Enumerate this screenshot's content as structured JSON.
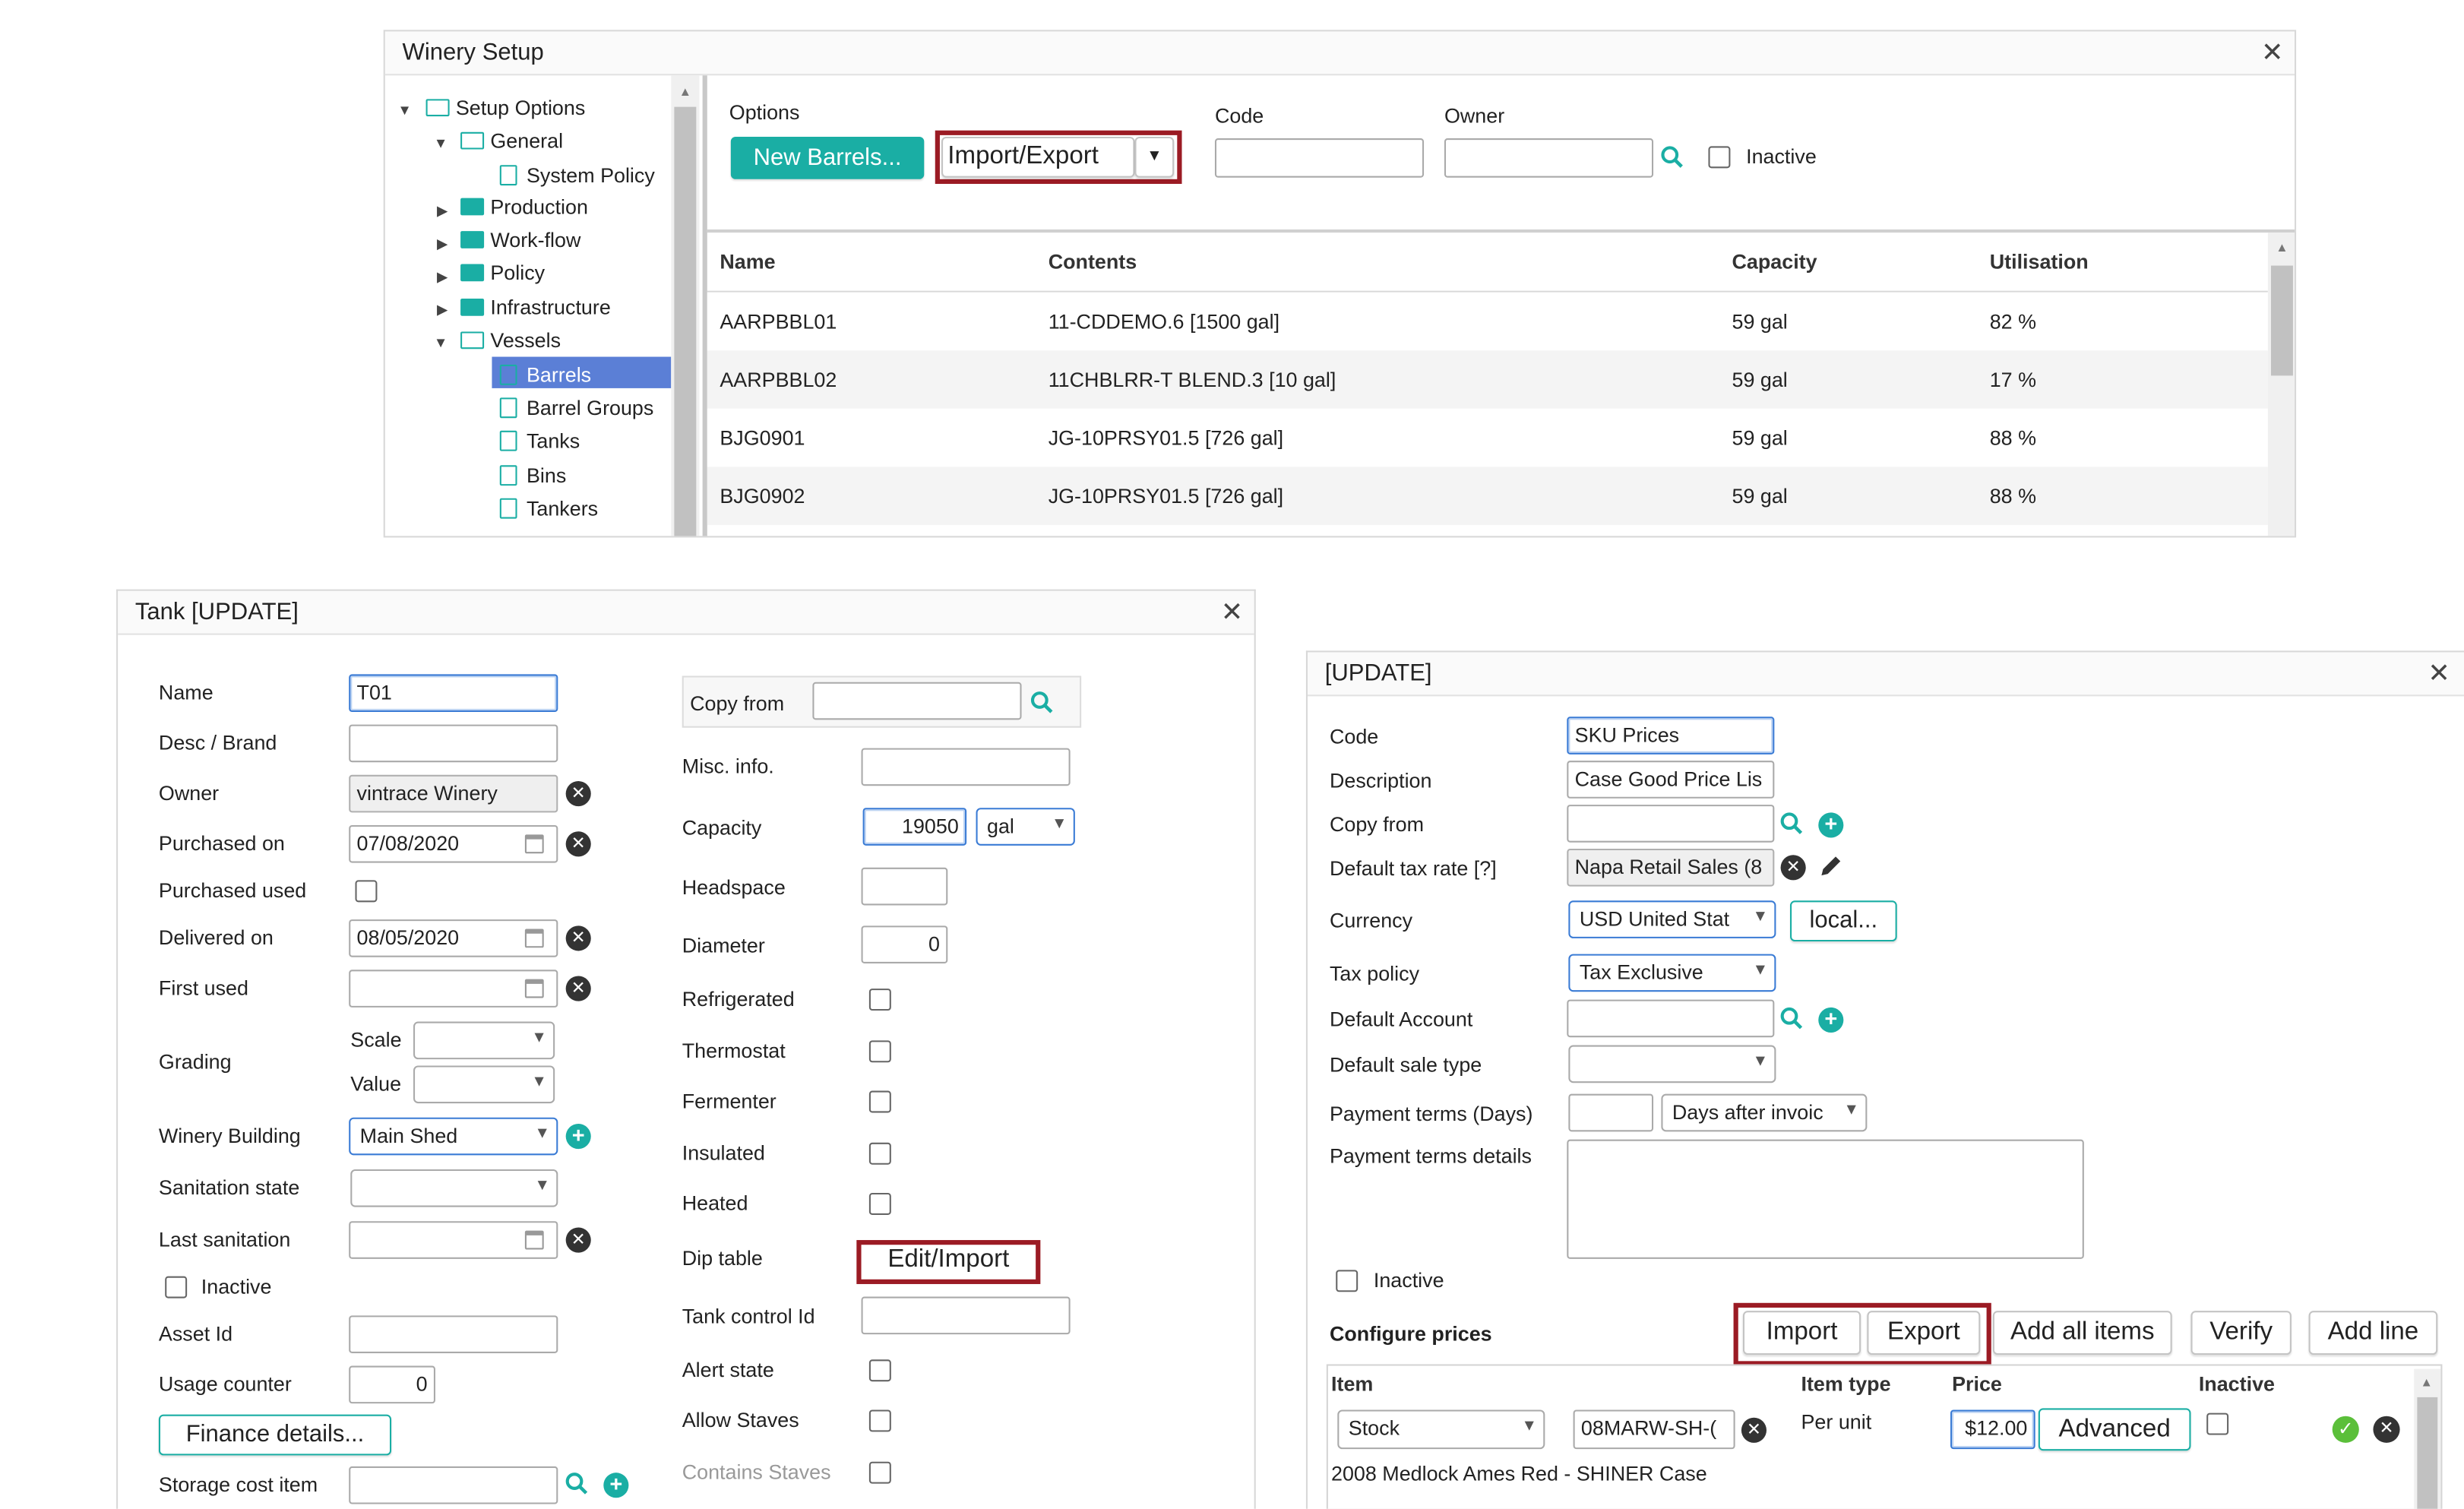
{
  "winery_setup": {
    "title": "Winery Setup",
    "tree": {
      "items": [
        {
          "label": "Setup Options",
          "expanded": true
        },
        {
          "label": "General",
          "expanded": true
        },
        {
          "label": "System Policy"
        },
        {
          "label": "Production"
        },
        {
          "label": "Work-flow"
        },
        {
          "label": "Policy"
        },
        {
          "label": "Infrastructure"
        },
        {
          "label": "Vessels",
          "expanded": true
        },
        {
          "label": "Barrels",
          "selected": true
        },
        {
          "label": "Barrel Groups"
        },
        {
          "label": "Tanks"
        },
        {
          "label": "Bins"
        },
        {
          "label": "Tankers"
        }
      ]
    },
    "options_label": "Options",
    "new_barrels_label": "New Barrels...",
    "import_export_label": "Import/Export",
    "code_label": "Code",
    "owner_label": "Owner",
    "inactive_label": "Inactive",
    "table": {
      "headers": [
        "Name",
        "Contents",
        "Capacity",
        "Utilisation"
      ],
      "rows": [
        [
          "AARPBBL01",
          "11-CDDEMO.6 [1500 gal]",
          "59 gal",
          "82 %"
        ],
        [
          "AARPBBL02",
          "11CHBLRR-T BLEND.3 [10 gal]",
          "59 gal",
          "17 %"
        ],
        [
          "BJG0901",
          "JG-10PRSY01.5 [726 gal]",
          "59 gal",
          "88 %"
        ],
        [
          "BJG0902",
          "JG-10PRSY01.5 [726 gal]",
          "59 gal",
          "88 %"
        ]
      ]
    }
  },
  "tank": {
    "title": "Tank [UPDATE]",
    "name_label": "Name",
    "name_value": "T01",
    "desc_label": "Desc / Brand",
    "desc_value": "",
    "owner_label": "Owner",
    "owner_value": "vintrace Winery",
    "purchased_on_label": "Purchased on",
    "purchased_on_value": "07/08/2020",
    "purchased_used_label": "Purchased used",
    "delivered_on_label": "Delivered on",
    "delivered_on_value": "08/05/2020",
    "first_used_label": "First used",
    "first_used_value": "",
    "grading_label": "Grading",
    "scale_label": "Scale",
    "value_label": "Value",
    "winery_building_label": "Winery Building",
    "winery_building_value": "Main Shed",
    "sanitation_state_label": "Sanitation state",
    "last_sanitation_label": "Last sanitation",
    "inactive_label": "Inactive",
    "asset_id_label": "Asset Id",
    "usage_counter_label": "Usage counter",
    "usage_counter_value": "0",
    "finance_details_label": "Finance details...",
    "storage_cost_label": "Storage cost item",
    "copy_from_label": "Copy from",
    "misc_info_label": "Misc. info.",
    "capacity_label": "Capacity",
    "capacity_value": "19050",
    "capacity_unit": "gal",
    "headspace_label": "Headspace",
    "diameter_label": "Diameter",
    "diameter_value": "0",
    "refrigerated_label": "Refrigerated",
    "thermostat_label": "Thermostat",
    "fermenter_label": "Fermenter",
    "insulated_label": "Insulated",
    "heated_label": "Heated",
    "dip_table_label": "Dip table",
    "edit_import_label": "Edit/Import",
    "tank_control_label": "Tank control Id",
    "alert_state_label": "Alert state",
    "allow_staves_label": "Allow Staves",
    "contains_staves_label": "Contains Staves"
  },
  "prices": {
    "title": "[UPDATE]",
    "code_label": "Code",
    "code_value": "SKU Prices",
    "description_label": "Description",
    "description_value": "Case Good Price Lis",
    "copy_from_label": "Copy from",
    "default_tax_label": "Default tax rate [?]",
    "default_tax_value": "Napa Retail Sales (8",
    "currency_label": "Currency",
    "currency_value": "USD United Stat",
    "local_label": "local...",
    "tax_policy_label": "Tax policy",
    "tax_policy_value": "Tax Exclusive",
    "default_account_label": "Default Account",
    "default_sale_type_label": "Default sale type",
    "payment_terms_label": "Payment terms (Days)",
    "payment_terms_type": "Days after invoic",
    "payment_details_label": "Payment terms details",
    "inactive_label": "Inactive",
    "configure_prices_label": "Configure prices",
    "import_label": "Import",
    "export_label": "Export",
    "add_all_items_label": "Add all items",
    "verify_label": "Verify",
    "add_line_label": "Add line",
    "table_headers": [
      "Item",
      "Item type",
      "Price",
      "Inactive"
    ],
    "row": {
      "stock_type": "Stock",
      "item_code": "08MARW-SH-(",
      "item_type": "Per unit",
      "price": "$12.00",
      "advanced_label": "Advanced",
      "description": "2008 Medlock Ames Red - SHINER Case"
    }
  }
}
